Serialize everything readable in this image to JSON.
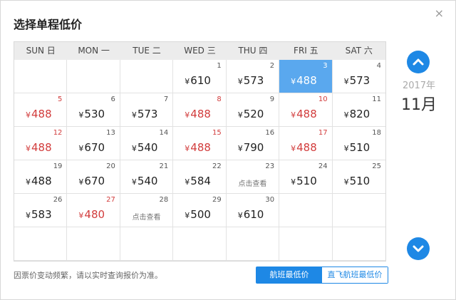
{
  "title": "选择单程低价",
  "close": "×",
  "weekdays": [
    "SUN 日",
    "MON 一",
    "TUE 二",
    "WED 三",
    "THU 四",
    "FRI 五",
    "SAT 六"
  ],
  "year": "2017年",
  "month": "11月",
  "currency": "¥",
  "cells": [
    {
      "day": "",
      "price": ""
    },
    {
      "day": "",
      "price": ""
    },
    {
      "day": "",
      "price": ""
    },
    {
      "day": "1",
      "price": "610"
    },
    {
      "day": "2",
      "price": "573"
    },
    {
      "day": "3",
      "price": "488",
      "selected": true
    },
    {
      "day": "4",
      "price": "573"
    },
    {
      "day": "5",
      "price": "488",
      "red": true
    },
    {
      "day": "6",
      "price": "530"
    },
    {
      "day": "7",
      "price": "573"
    },
    {
      "day": "8",
      "price": "488",
      "red": true
    },
    {
      "day": "9",
      "price": "520"
    },
    {
      "day": "10",
      "price": "488",
      "red": true
    },
    {
      "day": "11",
      "price": "820"
    },
    {
      "day": "12",
      "price": "488",
      "red": true
    },
    {
      "day": "13",
      "price": "670"
    },
    {
      "day": "14",
      "price": "540"
    },
    {
      "day": "15",
      "price": "488",
      "red": true
    },
    {
      "day": "16",
      "price": "790"
    },
    {
      "day": "17",
      "price": "488",
      "red": true
    },
    {
      "day": "18",
      "price": "510"
    },
    {
      "day": "19",
      "price": "488"
    },
    {
      "day": "20",
      "price": "670"
    },
    {
      "day": "21",
      "price": "540"
    },
    {
      "day": "22",
      "price": "584"
    },
    {
      "day": "23",
      "price": "",
      "query": "点击查看"
    },
    {
      "day": "24",
      "price": "510"
    },
    {
      "day": "25",
      "price": "510"
    },
    {
      "day": "26",
      "price": "583"
    },
    {
      "day": "27",
      "price": "480",
      "red": true
    },
    {
      "day": "28",
      "price": "",
      "query": "点击查看"
    },
    {
      "day": "29",
      "price": "500"
    },
    {
      "day": "30",
      "price": "610"
    },
    {
      "day": "",
      "price": ""
    },
    {
      "day": "",
      "price": ""
    },
    {
      "day": "",
      "price": ""
    },
    {
      "day": "",
      "price": ""
    },
    {
      "day": "",
      "price": ""
    },
    {
      "day": "",
      "price": ""
    },
    {
      "day": "",
      "price": ""
    },
    {
      "day": "",
      "price": ""
    },
    {
      "day": "",
      "price": ""
    }
  ],
  "note": "因票价变动频繁，请以实时查询报价为准。",
  "toggle": {
    "left": "航班最低价",
    "right": "直飞航班最低价"
  },
  "colors": {
    "accent": "#1e88e5",
    "selected": "#5aa8ee",
    "lowPrice": "#d23c3c"
  },
  "icons": {
    "prev": "chevron-up-icon",
    "next": "chevron-down-icon"
  }
}
